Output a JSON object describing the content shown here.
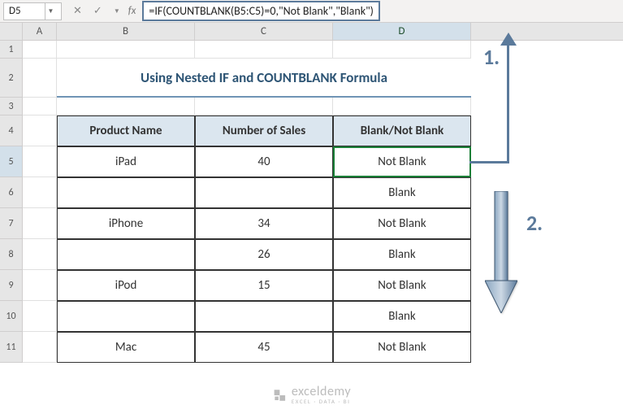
{
  "name_box": "D5",
  "formula": "=IF(COUNTBLANK(B5:C5)=0,\"Not Blank\",\"Blank\")",
  "columns": [
    "A",
    "B",
    "C",
    "D"
  ],
  "rows": [
    "1",
    "2",
    "3",
    "4",
    "5",
    "6",
    "7",
    "8",
    "9",
    "10",
    "11"
  ],
  "title": "Using Nested IF and COUNTBLANK Formula",
  "headers": {
    "product": "Product Name",
    "sales": "Number of Sales",
    "blank": "Blank/Not Blank"
  },
  "table": [
    {
      "product": "iPad",
      "sales": "40",
      "blank": "Not Blank"
    },
    {
      "product": "",
      "sales": "",
      "blank": "Blank"
    },
    {
      "product": "iPhone",
      "sales": "34",
      "blank": "Not Blank"
    },
    {
      "product": "",
      "sales": "26",
      "blank": "Blank"
    },
    {
      "product": "iPod",
      "sales": "15",
      "blank": "Not Blank"
    },
    {
      "product": "",
      "sales": "",
      "blank": "Blank"
    },
    {
      "product": "Mac",
      "sales": "45",
      "blank": "Not Blank"
    }
  ],
  "annotations": {
    "step1": "1.",
    "step2": "2."
  },
  "icons": {
    "cancel": "✕",
    "enter": "✓",
    "dropdown": "▼",
    "fx": "fx"
  },
  "watermark": {
    "main": "exceldemy",
    "sub": "EXCEL · DATA · BI"
  },
  "col_widths": {
    "A": 42,
    "B": 170,
    "C": 170,
    "D": 170
  },
  "row_heights": {
    "1": 22,
    "2": 48,
    "3": 22,
    "4": 38,
    "5": 38,
    "6": 38,
    "7": 38,
    "8": 38,
    "9": 38,
    "10": 38,
    "11": 38
  }
}
